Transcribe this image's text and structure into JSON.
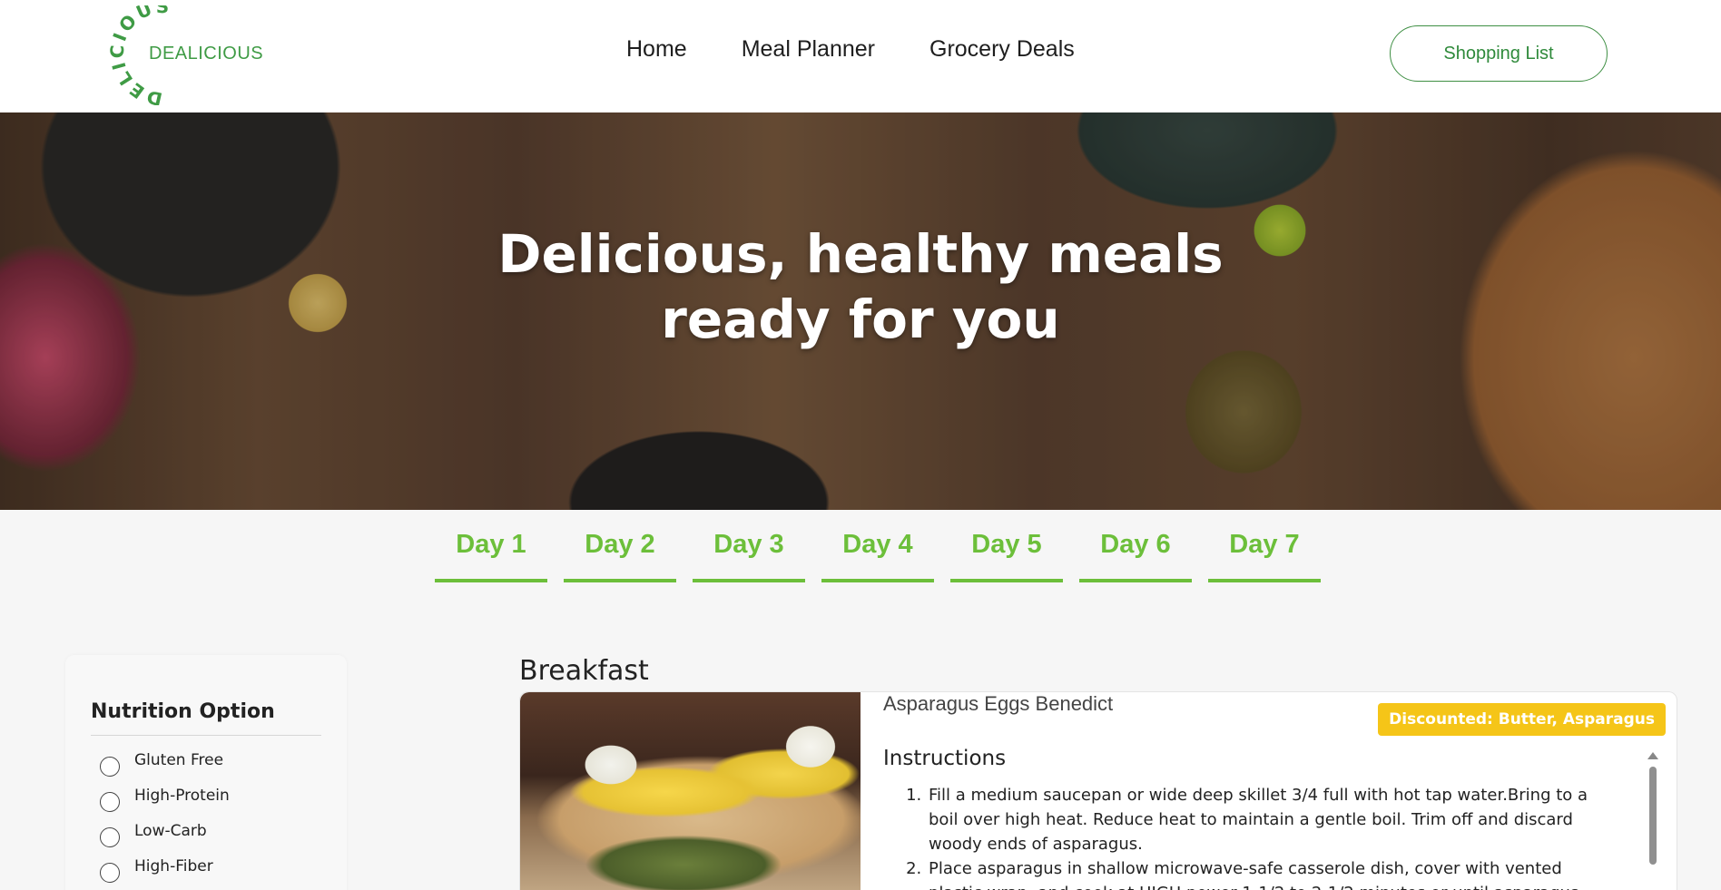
{
  "header": {
    "logo": {
      "ring_text": "DELICIOUS",
      "wordmark": "DEALICIOUS"
    },
    "nav": [
      "Home",
      "Meal Planner",
      "Grocery Deals"
    ],
    "shopping_list_label": "Shopping List",
    "colors": {
      "brand_green": "#3f9b45"
    }
  },
  "hero": {
    "title_line1": "Delicious, healthy meals",
    "title_line2": "ready for you"
  },
  "days": {
    "tabs": [
      "Day 1",
      "Day 2",
      "Day 3",
      "Day 4",
      "Day 5",
      "Day 6",
      "Day 7"
    ],
    "accent_color": "#6cbf3a"
  },
  "filter": {
    "title": "Nutrition Option",
    "options": [
      "Gluten Free",
      "High-Protein",
      "Low-Carb",
      "High-Fiber"
    ]
  },
  "meal": {
    "heading": "Breakfast",
    "recipe_name": "Asparagus Eggs Benedict",
    "badge": "Discounted: Butter, Asparagus",
    "badge_color": "#f5c518",
    "instructions_title": "Instructions",
    "steps": [
      "Fill a medium saucepan or wide deep skillet 3/4 full with hot tap water.Bring to a boil over high heat. Reduce heat to maintain a gentle boil. Trim off and discard woody ends of asparagus.",
      "Place asparagus in shallow microwave-safe casserole dish, cover with vented plastic wrap, and cook at HIGH power 1-1/2 to 2-1/2 minutes or until asparagus"
    ]
  }
}
